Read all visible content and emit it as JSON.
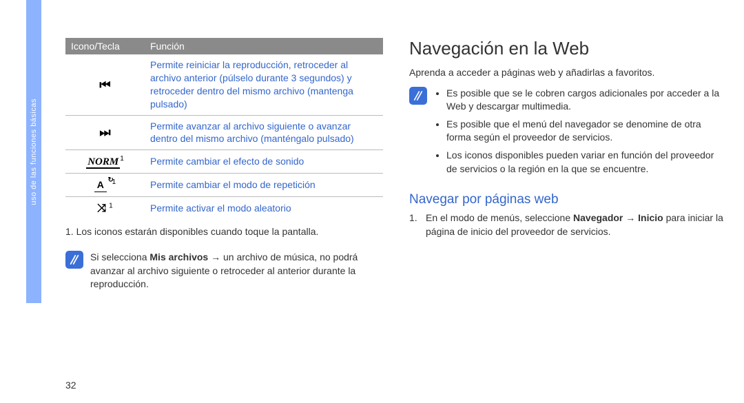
{
  "side_tab": "uso de las funciones básicas",
  "page_number": "32",
  "table": {
    "headers": [
      "Icono/Tecla",
      "Función"
    ],
    "rows": [
      {
        "icon_name": "rewind-icon",
        "icon_glyph": "⏮",
        "sup": "",
        "func": "Permite reiniciar la reproducción, retroceder al archivo anterior (púlselo durante 3 segundos) y retroceder dentro del mismo archivo (mantenga pulsado)"
      },
      {
        "icon_name": "forward-icon",
        "icon_glyph": "⏭",
        "sup": "",
        "func": "Permite avanzar al archivo siguiente o avanzar dentro del mismo archivo (manténgalo pulsado)"
      },
      {
        "icon_name": "norm-icon",
        "icon_label": "NORM",
        "sup": "1",
        "func": "Permite cambiar el efecto de sonido"
      },
      {
        "icon_name": "repeat-icon",
        "icon_label": "A",
        "sup": "1",
        "func": "Permite cambiar el modo de repetición"
      },
      {
        "icon_name": "shuffle-icon",
        "icon_glyph": "⤨",
        "sup": "1",
        "func": "Permite activar el modo aleatorio"
      }
    ]
  },
  "footnote": "1. Los iconos estarán disponibles cuando toque la pantalla.",
  "note_left": {
    "pre": "Si selecciona ",
    "bold": "Mis archivos",
    "arrow": " → ",
    "post": "un archivo de música, no podrá avanzar al archivo siguiente o retroceder al anterior durante la reproducción."
  },
  "right": {
    "heading": "Navegación en la Web",
    "intro": "Aprenda a acceder a páginas web y añadirlas a favoritos.",
    "note_items": [
      "Es posible que se le cobren cargos adicionales por acceder a la Web y descargar multimedia.",
      "Es posible que el menú del navegador se denomine de otra forma según el proveedor de servicios.",
      "Los iconos disponibles pueden variar en función del proveedor de servicios o la región en la que se encuentre."
    ],
    "subheading": "Navegar por páginas web",
    "step1": {
      "num": "1.",
      "pre": "En el modo de menús, seleccione ",
      "bold1": "Navegador",
      "arrow": " → ",
      "bold2": "Inicio",
      "post": " para iniciar la página de inicio del proveedor de servicios."
    }
  }
}
